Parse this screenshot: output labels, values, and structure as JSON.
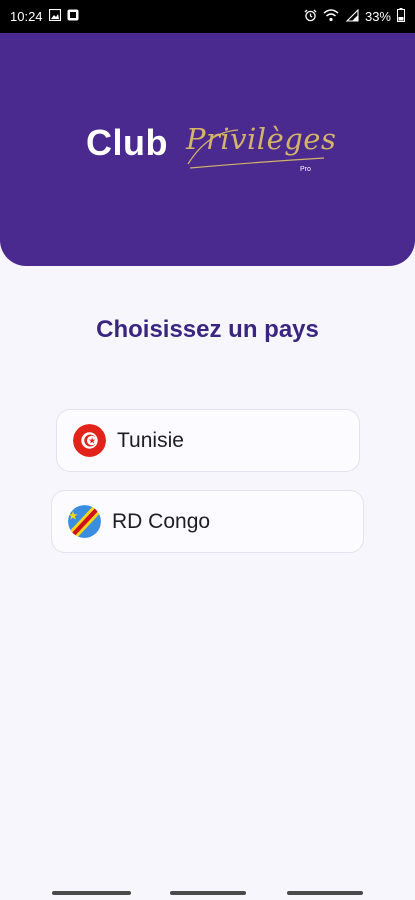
{
  "status_bar": {
    "time": "10:24",
    "battery": "33%",
    "icons": [
      "gallery-icon",
      "notification-icon",
      "alarm-icon",
      "wifi-icon",
      "signal-icon",
      "battery-icon"
    ]
  },
  "header": {
    "logo_club": "Club",
    "logo_privileges": "Privilèges",
    "logo_pro": "Pro",
    "background_color": "#4a2a8e",
    "accent_color": "#d4b36a"
  },
  "page_title": "Choisissez un pays",
  "countries": [
    {
      "name": "Tunisie",
      "flag_icon": "tunisia-flag-icon"
    },
    {
      "name": "RD Congo",
      "flag_icon": "drc-flag-icon"
    }
  ]
}
